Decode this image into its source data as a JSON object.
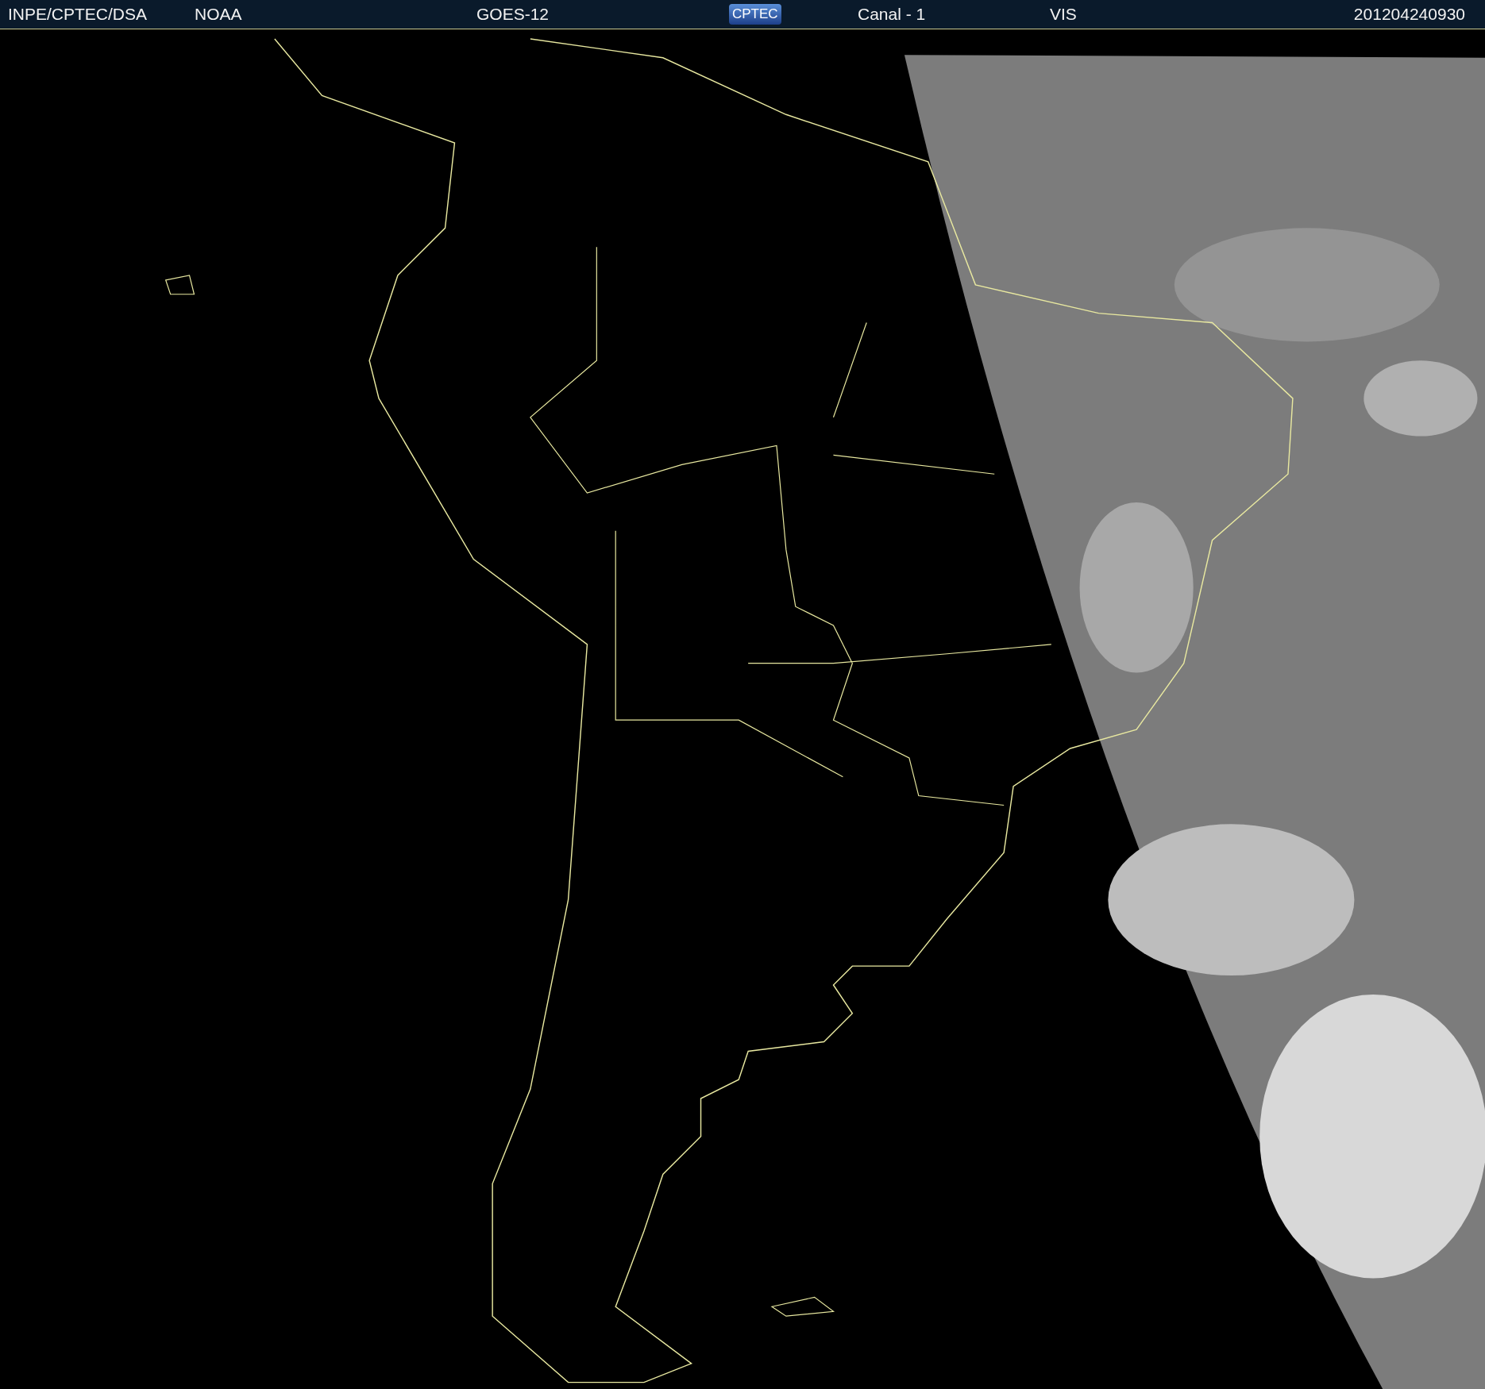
{
  "header": {
    "agency": "INPE/CPTEC/DSA",
    "source": "NOAA",
    "satellite": "GOES-12",
    "logo_text": "CPTEC",
    "channel": "Canal - 1",
    "band": "VIS",
    "timestamp": "201204240930"
  }
}
